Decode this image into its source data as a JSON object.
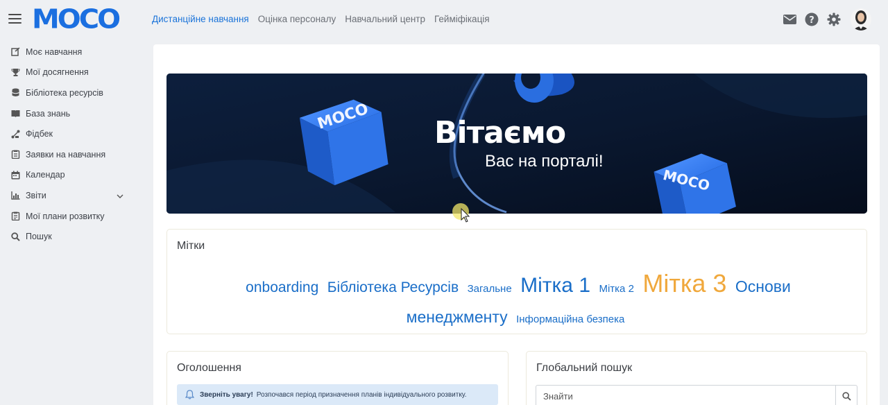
{
  "header": {
    "logo": "MOCO",
    "nav": [
      {
        "label": "Дистанційне навчання",
        "active": true
      },
      {
        "label": "Оцінка персоналу",
        "active": false
      },
      {
        "label": "Навчальний центр",
        "active": false
      },
      {
        "label": "Гейміфікація",
        "active": false
      }
    ],
    "icons": [
      "mail-icon",
      "help-icon",
      "gear-icon"
    ]
  },
  "sidebar": {
    "items": [
      {
        "label": "Моє навчання",
        "icon": "learning-icon"
      },
      {
        "label": "Мої досягнення",
        "icon": "trophy-icon"
      },
      {
        "label": "Бібліотека ресурсів",
        "icon": "database-icon"
      },
      {
        "label": "База знань",
        "icon": "book-icon"
      },
      {
        "label": "Фідбек",
        "icon": "feedback-icon"
      },
      {
        "label": "Заявки на навчання",
        "icon": "clipboard-icon"
      },
      {
        "label": "Календар",
        "icon": "calendar-icon"
      },
      {
        "label": "Звіти",
        "icon": "chart-icon",
        "expandable": true
      },
      {
        "label": "Мої плани розвитку",
        "icon": "plan-icon"
      },
      {
        "label": "Пошук",
        "icon": "search-icon"
      }
    ]
  },
  "banner": {
    "title": "Вітаємо",
    "subtitle": "Вас на порталі!",
    "cube_text_1": "MOCO",
    "cube_text_2": "MOCO"
  },
  "tags_card": {
    "title": "Мітки",
    "tags": [
      {
        "label": "onboarding",
        "size": 21,
        "color": "#1a6ec8"
      },
      {
        "label": "Бібліотека Ресурсів",
        "size": 21,
        "color": "#1a6ec8"
      },
      {
        "label": "Загальне",
        "size": 15,
        "color": "#1a6ec8"
      },
      {
        "label": "Мітка 1",
        "size": 30,
        "color": "#1a6ec8"
      },
      {
        "label": "Мітка 2",
        "size": 15,
        "color": "#1a6ec8"
      },
      {
        "label": "Мітка 3",
        "size": 36,
        "color": "#f0a83c"
      },
      {
        "label": "Основи менеджменту",
        "size": 23,
        "color": "#1a6ec8"
      },
      {
        "label": "Інформаційна безпека",
        "size": 15,
        "color": "#1a6ec8"
      }
    ]
  },
  "announcements": {
    "title": "Оголошення",
    "notice_strong": "Зверніть увагу!",
    "notice_text": "Розпочався період призначення планів індивідуального розвитку."
  },
  "global_search": {
    "title": "Глобальний пошук",
    "placeholder": "Знайти"
  }
}
